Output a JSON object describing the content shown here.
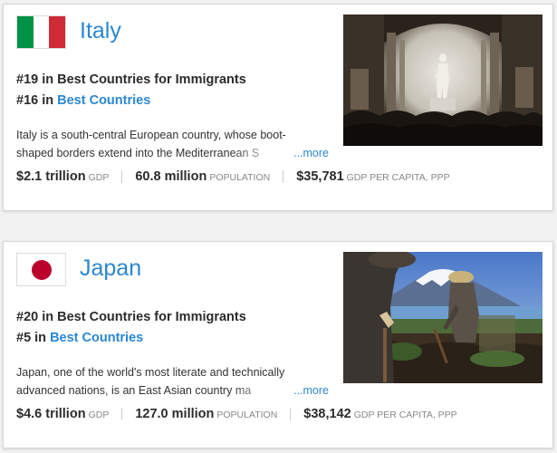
{
  "cards": [
    {
      "country": "Italy",
      "flag_colors": [
        "#009246",
        "#ffffff",
        "#ce2b37"
      ],
      "rank_immigrants": "#19 in Best Countries for Immigrants",
      "rank_prefix": "#16 in ",
      "rank_link": "Best Countries",
      "desc_line1": "Italy is a south-central European country, whose boot-",
      "desc_line2": "shaped borders extend into the Mediterranean S",
      "more": "...more",
      "gdp_value": "$2.1 trillion",
      "gdp_label": "GDP",
      "pop_value": "60.8 million",
      "pop_label": "POPULATION",
      "gdppc_value": "$35,781",
      "gdppc_label": "GDP PER CAPITA, PPP",
      "photo_icon": "statue-of-david-photo"
    },
    {
      "country": "Japan",
      "flag_colors": [
        "#ffffff",
        "#bc002d"
      ],
      "rank_immigrants": "#20 in Best Countries for Immigrants",
      "rank_prefix": "#5 in ",
      "rank_link": "Best Countries",
      "desc_line1": "Japan, one of the world's most literate and technically",
      "desc_line2": "advanced nations, is an East Asian country ma",
      "more": "...more",
      "gdp_value": "$4.6 trillion",
      "gdp_label": "GDP",
      "pop_value": "127.0 million",
      "pop_label": "POPULATION",
      "gdppc_value": "$38,142",
      "gdppc_label": "GDP PER CAPITA, PPP",
      "photo_icon": "mount-fuji-farmers-photo"
    }
  ]
}
